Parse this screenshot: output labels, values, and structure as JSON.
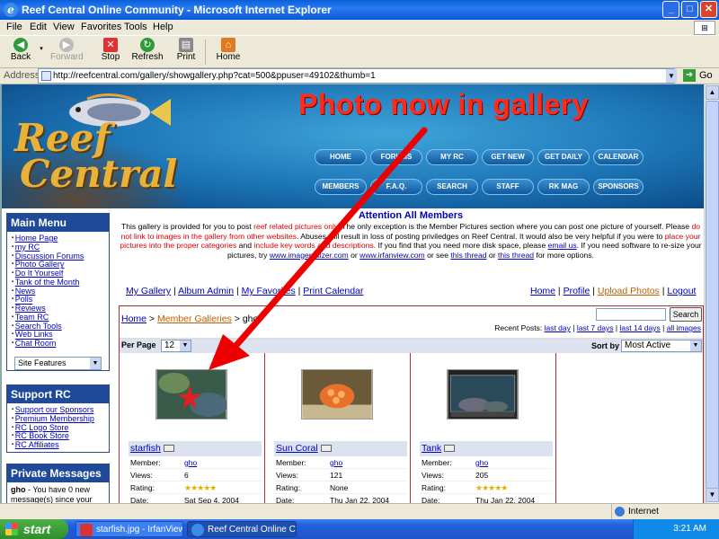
{
  "window": {
    "title": "Reef Central Online Community - Microsoft Internet Explorer",
    "controls": [
      "_",
      "□",
      "✕"
    ]
  },
  "menu": [
    "File",
    "Edit",
    "View",
    "Favorites",
    "Tools",
    "Help"
  ],
  "toolbar": {
    "back": "Back",
    "forward": "Forward",
    "stop": "Stop",
    "refresh": "Refresh",
    "print": "Print",
    "home": "Home"
  },
  "address": {
    "label": "Address",
    "url": "http://reefcentral.com/gallery/showgallery.php?cat=500&ppuser=49102&thumb=1",
    "go": "Go"
  },
  "banner": {
    "logo_line1": "Reef",
    "logo_line2": "Central",
    "headline": "Photo now in gallery",
    "nav_row1": [
      "HOME",
      "FORUMS",
      "MY RC",
      "GET NEW",
      "GET DAILY",
      "CALENDAR"
    ],
    "nav_row2": [
      "MEMBERS",
      "F.A.Q.",
      "SEARCH",
      "STAFF",
      "RK MAG",
      "SPONSORS"
    ]
  },
  "main_menu": {
    "title": "Main Menu",
    "items": [
      "Home Page",
      "my RC",
      "Discussion Forums",
      "Photo Gallery",
      "Do It Yourself",
      "Tank of the Month",
      "News",
      "Polls",
      "Reviews",
      "Team RC",
      "Search Tools",
      "Web Links",
      "Chat Room"
    ],
    "select": "Site Features"
  },
  "support": {
    "title": "Support RC",
    "items": [
      "Support our Sponsors",
      "Premium Membership",
      "RC Logo Store",
      "RC Book Store",
      "RC Affiliates"
    ]
  },
  "pm": {
    "title": "Private Messages",
    "user": "gho",
    "text": " - You have 0 new message(s) since your"
  },
  "attention": {
    "title": "Attention All Members",
    "p1": "This gallery is provided for you to post ",
    "p1_red": "reef related pictures only",
    "p2": ". The only exception is the Member Pictures section where you can post one picture of yourself. Please ",
    "p2_red": "do not link to images in the gallery from other websites",
    "p3": ". Abuses will result in loss of posting priviledges on Reef Central. It would also be very helpful if you were to ",
    "p3_red": "place your pictures into the proper categories",
    "p4": " and ",
    "p4_red": "include key words and descriptions",
    "p5": ". If you find that you need more disk space, please ",
    "email": "email us",
    "p6": ". If you need software to re-size your pictures, try ",
    "link1": "www.imageresizer.com",
    "p7": " or ",
    "link2": "www.irfanview.com",
    "p8": " or see ",
    "link3": "this thread",
    "p9": " or ",
    "link4": "this thread",
    "p10": " for more options."
  },
  "gallery_links_left": [
    "My Gallery",
    "Album Admin",
    "My Favorites",
    "Print Calendar"
  ],
  "gallery_links_right": [
    "Home",
    "Profile",
    "Upload Photos",
    "Logout"
  ],
  "gallery": {
    "crumb_home": "Home",
    "crumb_sep": " > ",
    "crumb_mg": "Member Galleries",
    "crumb_user": "gho",
    "search_btn": "Search",
    "recent_label": "Recent Posts:",
    "recent_links": [
      "last day",
      "last 7 days",
      "last 14 days",
      "all images"
    ],
    "per_page_label": "Per Page",
    "per_page_value": "12",
    "sort_label": "Sort by",
    "sort_value": "Most Active",
    "labels": {
      "member": "Member:",
      "views": "Views:",
      "rating": "Rating:",
      "date": "Date:"
    },
    "photos": [
      {
        "name": "starfish",
        "member": "gho",
        "views": "6",
        "rating": "★★★★★",
        "date": "Sat Sep 4, 2004"
      },
      {
        "name": "Sun Coral",
        "member": "gho",
        "views": "121",
        "rating": "None",
        "date": "Thu Jan 22, 2004"
      },
      {
        "name": "Tank",
        "member": "gho",
        "views": "205",
        "rating": "★★★★★",
        "date": "Thu Jan 22, 2004"
      }
    ]
  },
  "status": {
    "zone": "Internet"
  },
  "taskbar": {
    "start": "start",
    "tasks": [
      "starfish.jpg - IrfanView",
      "Reef Central Online C..."
    ],
    "clock": "3:21 AM"
  }
}
